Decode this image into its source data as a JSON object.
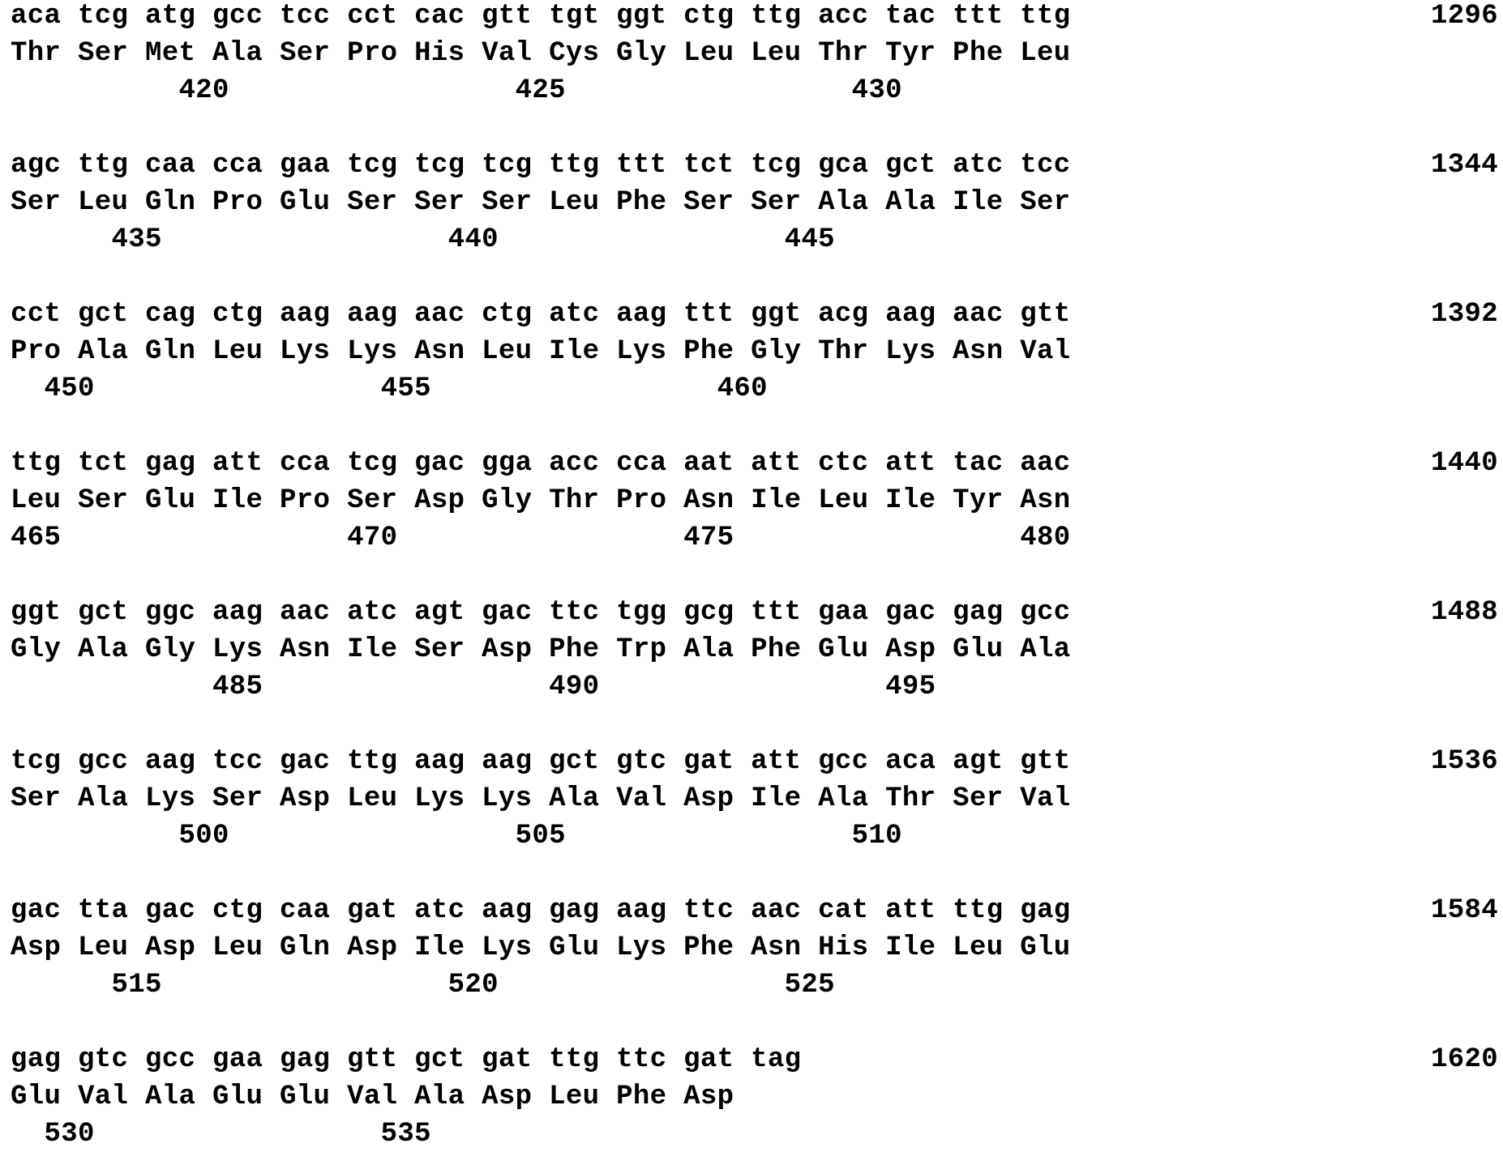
{
  "blocks": [
    {
      "nucleotides": "aca tcg atg gcc tcc cct cac gtt tgt ggt ctg ttg acc tac ttt ttg",
      "amino_acids": "Thr Ser Met Ala Ser Pro His Val Cys Gly Leu Leu Thr Tyr Phe Leu",
      "positions": "          420                 425                 430",
      "nt_number": "1296"
    },
    {
      "nucleotides": "agc ttg caa cca gaa tcg tcg tcg ttg ttt tct tcg gca gct atc tcc",
      "amino_acids": "Ser Leu Gln Pro Glu Ser Ser Ser Leu Phe Ser Ser Ala Ala Ile Ser",
      "positions": "      435                 440                 445",
      "nt_number": "1344"
    },
    {
      "nucleotides": "cct gct cag ctg aag aag aac ctg atc aag ttt ggt acg aag aac gtt",
      "amino_acids": "Pro Ala Gln Leu Lys Lys Asn Leu Ile Lys Phe Gly Thr Lys Asn Val",
      "positions": "  450                 455                 460",
      "nt_number": "1392"
    },
    {
      "nucleotides": "ttg tct gag att cca tcg gac gga acc cca aat att ctc att tac aac",
      "amino_acids": "Leu Ser Glu Ile Pro Ser Asp Gly Thr Pro Asn Ile Leu Ile Tyr Asn",
      "positions": "465                 470                 475                 480",
      "nt_number": "1440"
    },
    {
      "nucleotides": "ggt gct ggc aag aac atc agt gac ttc tgg gcg ttt gaa gac gag gcc",
      "amino_acids": "Gly Ala Gly Lys Asn Ile Ser Asp Phe Trp Ala Phe Glu Asp Glu Ala",
      "positions": "            485                 490                 495",
      "nt_number": "1488"
    },
    {
      "nucleotides": "tcg gcc aag tcc gac ttg aag aag gct gtc gat att gcc aca agt gtt",
      "amino_acids": "Ser Ala Lys Ser Asp Leu Lys Lys Ala Val Asp Ile Ala Thr Ser Val",
      "positions": "          500                 505                 510",
      "nt_number": "1536"
    },
    {
      "nucleotides": "gac tta gac ctg caa gat atc aag gag aag ttc aac cat att ttg gag",
      "amino_acids": "Asp Leu Asp Leu Gln Asp Ile Lys Glu Lys Phe Asn His Ile Leu Glu",
      "positions": "      515                 520                 525",
      "nt_number": "1584"
    },
    {
      "nucleotides": "gag gtc gcc gaa gag gtt gct gat ttg ttc gat tag",
      "amino_acids": "Glu Val Ala Glu Glu Val Ala Asp Leu Phe Asp",
      "positions": "  530                 535",
      "nt_number": "1620"
    }
  ]
}
